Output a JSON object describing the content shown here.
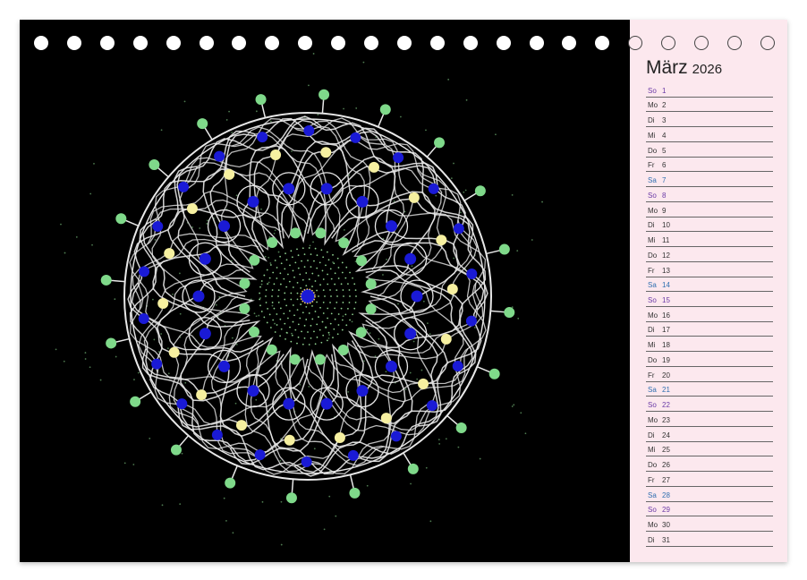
{
  "calendar": {
    "month": "März",
    "year": "2026",
    "days": [
      {
        "wd": "So",
        "num": "1",
        "type": "sun"
      },
      {
        "wd": "Mo",
        "num": "2",
        "type": "week"
      },
      {
        "wd": "Di",
        "num": "3",
        "type": "week"
      },
      {
        "wd": "Mi",
        "num": "4",
        "type": "week"
      },
      {
        "wd": "Do",
        "num": "5",
        "type": "week"
      },
      {
        "wd": "Fr",
        "num": "6",
        "type": "week"
      },
      {
        "wd": "Sa",
        "num": "7",
        "type": "sat"
      },
      {
        "wd": "So",
        "num": "8",
        "type": "sun"
      },
      {
        "wd": "Mo",
        "num": "9",
        "type": "week"
      },
      {
        "wd": "Di",
        "num": "10",
        "type": "week"
      },
      {
        "wd": "Mi",
        "num": "11",
        "type": "week"
      },
      {
        "wd": "Do",
        "num": "12",
        "type": "week"
      },
      {
        "wd": "Fr",
        "num": "13",
        "type": "week"
      },
      {
        "wd": "Sa",
        "num": "14",
        "type": "sat"
      },
      {
        "wd": "So",
        "num": "15",
        "type": "sun"
      },
      {
        "wd": "Mo",
        "num": "16",
        "type": "week"
      },
      {
        "wd": "Di",
        "num": "17",
        "type": "week"
      },
      {
        "wd": "Mi",
        "num": "18",
        "type": "week"
      },
      {
        "wd": "Do",
        "num": "19",
        "type": "week"
      },
      {
        "wd": "Fr",
        "num": "20",
        "type": "week"
      },
      {
        "wd": "Sa",
        "num": "21",
        "type": "sat"
      },
      {
        "wd": "So",
        "num": "22",
        "type": "sun"
      },
      {
        "wd": "Mo",
        "num": "23",
        "type": "week"
      },
      {
        "wd": "Di",
        "num": "24",
        "type": "week"
      },
      {
        "wd": "Mi",
        "num": "25",
        "type": "week"
      },
      {
        "wd": "Do",
        "num": "26",
        "type": "week"
      },
      {
        "wd": "Fr",
        "num": "27",
        "type": "week"
      },
      {
        "wd": "Sa",
        "num": "28",
        "type": "sat"
      },
      {
        "wd": "So",
        "num": "29",
        "type": "sun"
      },
      {
        "wd": "Mo",
        "num": "30",
        "type": "week"
      },
      {
        "wd": "Di",
        "num": "31",
        "type": "week"
      }
    ]
  },
  "colors": {
    "photo_bg": "#000000",
    "panel_bg": "#fce8ee",
    "outer_dot": "#7fd98a",
    "blue_dot": "#1a1ad6",
    "yellow_dot": "#f6f0a0",
    "strand": "#e8e8e8",
    "saturday": "#2f6fb0",
    "sunday": "#6a3aa6"
  },
  "icons": {
    "binding": "spiral-binding-hole-icon",
    "artwork": "mandala-artwork"
  }
}
